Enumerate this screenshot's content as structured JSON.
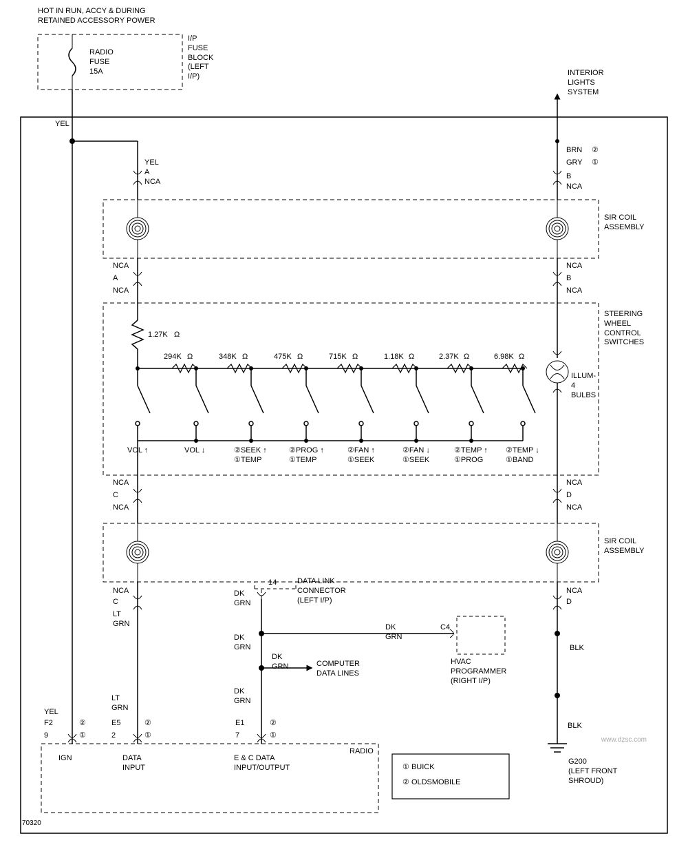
{
  "header": {
    "hot_in": "HOT IN RUN, ACCY & DURING\nRETAINED ACCESSORY POWER",
    "fuse_label": "RADIO\nFUSE\n15A",
    "fuse_block": "I/P\nFUSE\nBLOCK\n(LEFT\nI/P)",
    "interior_lights": "INTERIOR\nLIGHTS\nSYSTEM"
  },
  "wires": {
    "yel": "YEL",
    "yel_a_nca": "YEL\nA\nNCA",
    "brn": "BRN",
    "gry": "GRY",
    "b": "B",
    "nca": "NCA",
    "a": "A",
    "c": "C",
    "d": "D",
    "lt_grn": "LT\nGRN",
    "dk_grn": "DK\nGRN",
    "blk": "BLK",
    "nca_c": "NCA\nC",
    "nca_d": "NCA\nD"
  },
  "blocks": {
    "sir_coil_upper": "SIR COIL\nASSEMBLY",
    "steering": "STEERING\nWHEEL\nCONTROL\nSWITCHES",
    "sir_coil_lower": "SIR COIL\nASSEMBLY",
    "illum": "ILLUM-\n4\nBULBS",
    "dlc": "DATA LINK\nCONNECTOR\n(LEFT I/P)",
    "hvac": "HVAC\nPROGRAMMER\n(RIGHT I/P)",
    "computer_data": "COMPUTER\nDATA LINES",
    "radio": "RADIO",
    "g200": "G200\n(LEFT FRONT\nSHROUD)"
  },
  "resistors": {
    "main": "1.27K",
    "values": [
      "294K",
      "348K",
      "475K",
      "715K",
      "1.18K",
      "2.37K",
      "6.98K"
    ],
    "ohm": "Ω"
  },
  "switches": {
    "labels_top": [
      "VOL",
      "VOL",
      "SEEK",
      "PROG",
      "FAN",
      "FAN",
      "TEMP",
      "TEMP"
    ],
    "labels_bot": [
      "",
      "",
      "TEMP",
      "TEMP",
      "SEEK",
      "SEEK",
      "PROG",
      "BAND"
    ],
    "arrows": [
      "↑",
      "↓",
      "↑",
      "↑",
      "↑",
      "↓",
      "↑",
      "↓"
    ]
  },
  "connectors": {
    "c4": "C4",
    "pin14": "14",
    "e5": "E5",
    "e1": "E1",
    "f2": "F2",
    "p9": "9",
    "p2": "2",
    "p7": "7",
    "c2": "②",
    "c1": "①"
  },
  "radio_ports": {
    "ign": "IGN",
    "data_input": "DATA\nINPUT",
    "ec_data": "E & C DATA\nINPUT/OUTPUT"
  },
  "legend": {
    "buick": "BUICK",
    "olds": "OLDSMOBILE",
    "n1": "①",
    "n2": "②"
  },
  "figure_id": "70320",
  "watermark": "www.dzsc.com"
}
